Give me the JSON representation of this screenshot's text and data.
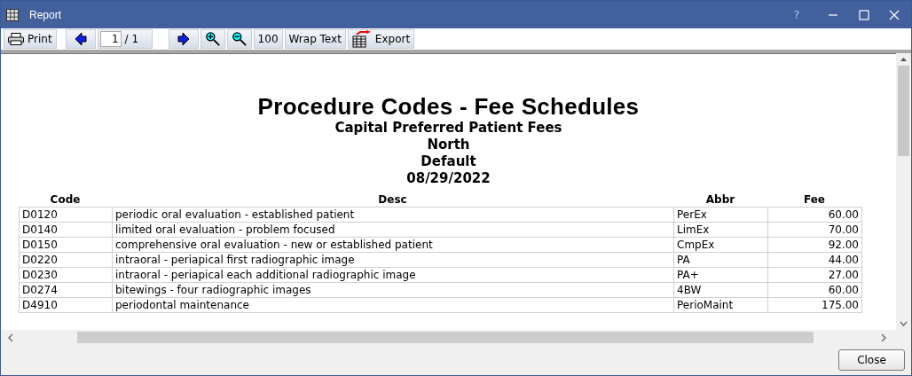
{
  "window": {
    "title": "Report",
    "help": "?"
  },
  "toolbar": {
    "print": "Print",
    "page_value": "1",
    "page_total": "/ 1",
    "zoom_reset": "100",
    "wrap_text": "Wrap Text",
    "export": "Export"
  },
  "report": {
    "title": "Procedure Codes - Fee Schedules",
    "subtitles": [
      "Capital Preferred Patient Fees",
      "North",
      "Default",
      "08/29/2022"
    ],
    "columns": [
      "Code",
      "Desc",
      "Abbr",
      "Fee"
    ],
    "rows": [
      [
        "D0120",
        "periodic oral evaluation - established patient",
        "PerEx",
        "60.00"
      ],
      [
        "D0140",
        "limited oral evaluation - problem focused",
        "LimEx",
        "70.00"
      ],
      [
        "D0150",
        "comprehensive oral evaluation - new or established patient",
        "CmpEx",
        "92.00"
      ],
      [
        "D0220",
        "intraoral - periapical first radiographic image",
        "PA",
        "44.00"
      ],
      [
        "D0230",
        "intraoral - periapical each additional radiographic image",
        "PA+",
        "27.00"
      ],
      [
        "D0274",
        "bitewings - four radiographic images",
        "4BW",
        "60.00"
      ],
      [
        "D4910",
        "periodontal maintenance",
        "PerioMaint",
        "175.00"
      ]
    ]
  },
  "footer": {
    "close": "Close"
  }
}
